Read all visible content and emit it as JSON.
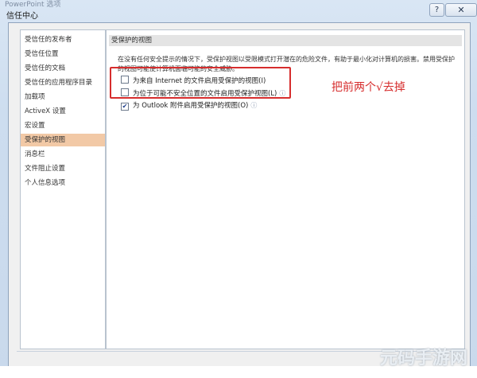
{
  "window": {
    "ghost_title": "PowerPoint 选项",
    "title": "信任中心",
    "help_glyph": "?",
    "close_glyph": "✕"
  },
  "sidebar": {
    "items": [
      {
        "label": "受信任的发布者"
      },
      {
        "label": "受信任位置"
      },
      {
        "label": "受信任的文档"
      },
      {
        "label": "受信任的应用程序目录"
      },
      {
        "label": "加载项"
      },
      {
        "label": "ActiveX 设置"
      },
      {
        "label": "宏设置"
      },
      {
        "label": "受保护的视图"
      },
      {
        "label": "消息栏"
      },
      {
        "label": "文件阻止设置"
      },
      {
        "label": "个人信息选项"
      }
    ],
    "selected_index": 7
  },
  "main": {
    "section_title": "受保护的视图",
    "description": "在没有任何安全提示的情况下，受保护视图以受限模式打开潜在的危险文件，有助于最小化对计算机的损害。禁用受保护的视图可能使计算机面临可能的安全威胁。",
    "options": [
      {
        "label": "为来自 Internet 的文件启用受保护的视图(I)",
        "checked": false,
        "check_glyph": ""
      },
      {
        "label": "为位于可能不安全位置的文件启用受保护视图(L)",
        "checked": false,
        "check_glyph": ""
      },
      {
        "label": "为 Outlook 附件启用受保护的视图(O)",
        "checked": true,
        "check_glyph": "✔"
      }
    ],
    "info_glyph": "ⓘ"
  },
  "annotation": {
    "text": "把前两个√去掉",
    "color": "#d62d2d"
  },
  "watermark": {
    "text": "元码手游网"
  }
}
